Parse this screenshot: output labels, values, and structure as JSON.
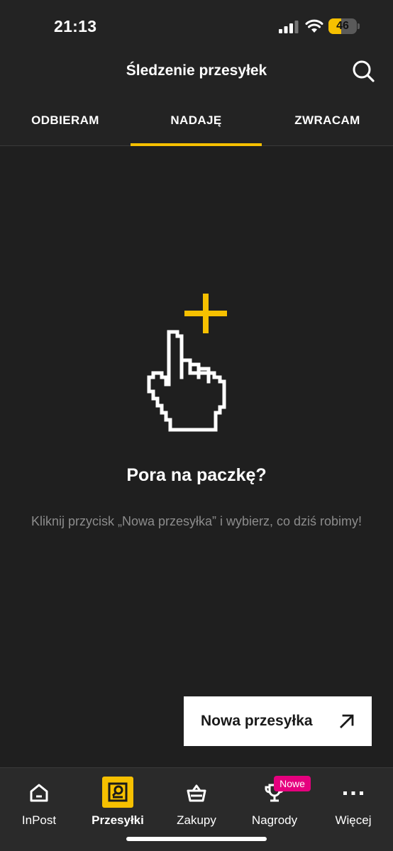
{
  "status_bar": {
    "time": "21:13",
    "battery_percent": "46",
    "battery_level": 0.46,
    "icons": [
      "cellular-signal-icon",
      "wifi-icon",
      "battery-icon"
    ]
  },
  "header": {
    "title": "Śledzenie przesyłek",
    "search_icon": "search-icon"
  },
  "tabs": [
    {
      "label": "ODBIERAM",
      "active": false
    },
    {
      "label": "NADAJĘ",
      "active": true
    },
    {
      "label": "ZWRACAM",
      "active": false
    }
  ],
  "empty_state": {
    "illustration": "pointing-hand-icon",
    "title": "Pora na paczkę?",
    "description": "Kliknij przycisk „Nowa przesyłka” i wybierz, co dziś robimy!"
  },
  "cta": {
    "label": "Nowa przesyłka",
    "icon": "arrow-up-right-icon"
  },
  "bottom_nav": {
    "items": [
      {
        "label": "InPost",
        "icon": "home-icon",
        "active": false
      },
      {
        "label": "Przesyłki",
        "icon": "parcel-search-icon",
        "active": true
      },
      {
        "label": "Zakupy",
        "icon": "basket-icon",
        "active": false
      },
      {
        "label": "Nagrody",
        "icon": "trophy-icon",
        "active": false,
        "badge": "Nowe"
      },
      {
        "label": "Więcej",
        "icon": "more-icon",
        "active": false
      }
    ]
  },
  "colors": {
    "accent": "#f6c000",
    "background": "#1f1f1f",
    "badge": "#e5007e"
  }
}
